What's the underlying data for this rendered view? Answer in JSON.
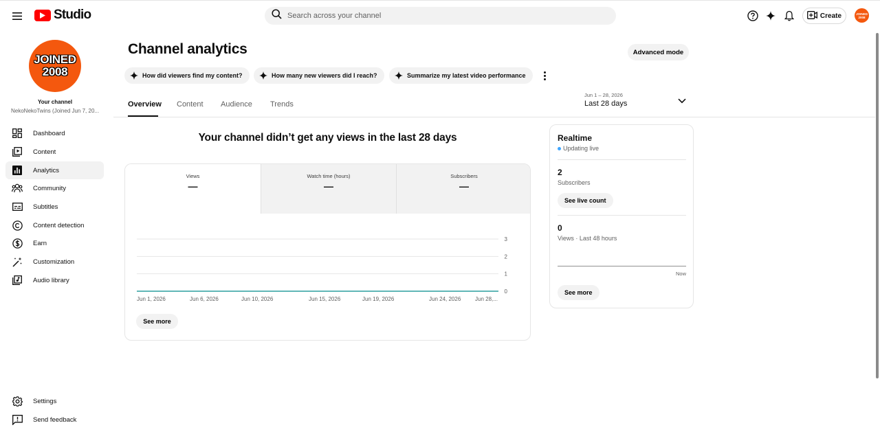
{
  "header": {
    "logo_text": "Studio",
    "search_placeholder": "Search across your channel",
    "create_label": "Create",
    "avatar_text": "JOINED 2008"
  },
  "sidebar": {
    "avatar_line1": "JOINED",
    "avatar_line2": "2008",
    "your_channel": "Your channel",
    "channel_name": "NekoNekoTwins (Joined Jun 7, 20...",
    "items": [
      {
        "label": "Dashboard",
        "icon": "dashboard-icon"
      },
      {
        "label": "Content",
        "icon": "content-icon"
      },
      {
        "label": "Analytics",
        "icon": "analytics-icon",
        "active": true
      },
      {
        "label": "Community",
        "icon": "community-icon"
      },
      {
        "label": "Subtitles",
        "icon": "subtitles-icon"
      },
      {
        "label": "Content detection",
        "icon": "copyright-icon"
      },
      {
        "label": "Earn",
        "icon": "dollar-icon"
      },
      {
        "label": "Customization",
        "icon": "magic-wand-icon"
      },
      {
        "label": "Audio library",
        "icon": "audio-library-icon"
      }
    ],
    "bottom": [
      {
        "label": "Settings",
        "icon": "gear-icon"
      },
      {
        "label": "Send feedback",
        "icon": "feedback-icon"
      }
    ]
  },
  "main": {
    "title": "Channel analytics",
    "advanced_mode": "Advanced mode",
    "chips": [
      "How did viewers find my content?",
      "How many new viewers did I reach?",
      "Summarize my latest video performance"
    ],
    "tabs": [
      "Overview",
      "Content",
      "Audience",
      "Trends"
    ],
    "date_range": "Jun 1 – 28, 2026",
    "date_label": "Last 28 days",
    "headline": "Your channel didn’t get any views in the last 28 days",
    "metrics": [
      {
        "name": "Views",
        "value": "—"
      },
      {
        "name": "Watch time (hours)",
        "value": "—"
      },
      {
        "name": "Subscribers",
        "value": "—"
      }
    ],
    "see_more": "See more"
  },
  "chart_data": {
    "type": "line",
    "x_tick_labels": [
      "Jun 1, 2026",
      "Jun 6, 2026",
      "Jun 10, 2026",
      "Jun 15, 2026",
      "Jun 19, 2026",
      "Jun 24, 2026",
      "Jun 28,..."
    ],
    "y_ticks": [
      0,
      1,
      2,
      3
    ],
    "ylim": [
      0,
      3
    ],
    "series": [
      {
        "values": [
          0,
          0
        ]
      }
    ],
    "line_color": "#2a9d9d",
    "grid": true
  },
  "realtime": {
    "title": "Realtime",
    "status": "Updating live",
    "subscribers_value": "2",
    "subscribers_label": "Subscribers",
    "see_live_count": "See live count",
    "views_value": "0",
    "views_label": "Views · Last 48 hours",
    "now_label": "Now",
    "see_more": "See more"
  }
}
